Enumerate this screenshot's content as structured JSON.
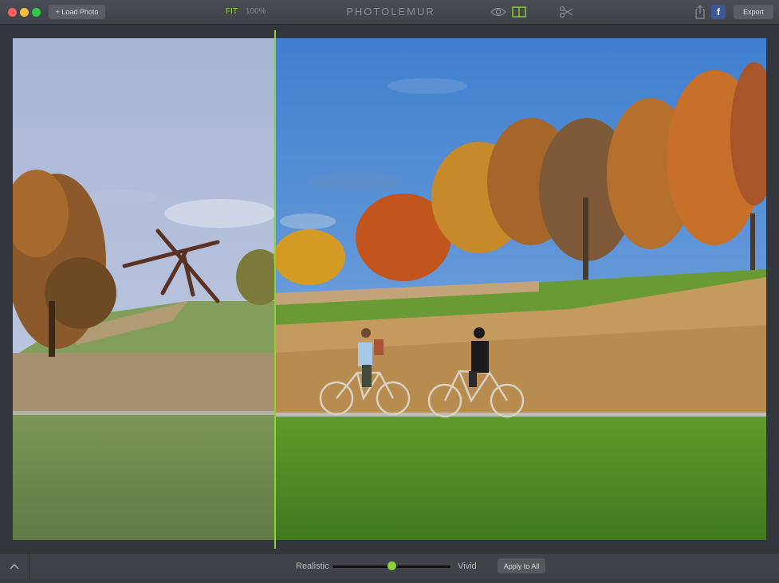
{
  "toolbar": {
    "load_photo_label": "+ Load Photo",
    "fit_label": "FIT",
    "zoom_label": "100%",
    "brand": "PHOTOLEMUR",
    "export_label": "Export",
    "facebook_label": "f"
  },
  "bottom": {
    "realistic_label": "Realistic",
    "vivid_label": "Vivid",
    "apply_label": "Apply to All",
    "slider_value": 0.5
  },
  "colors": {
    "accent": "#8bd13a",
    "facebook": "#3b5998"
  }
}
